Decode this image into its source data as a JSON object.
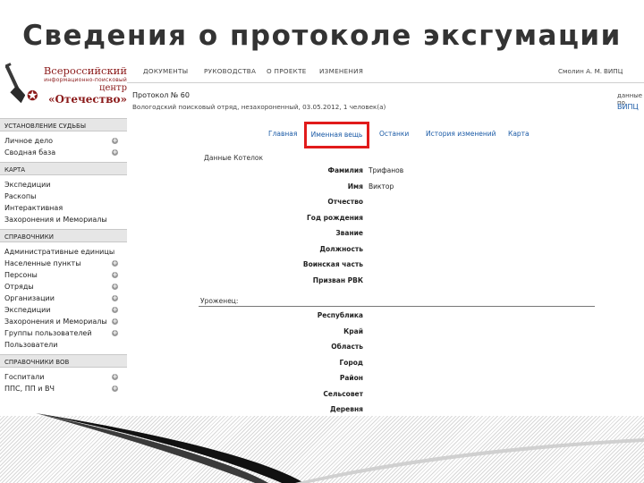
{
  "slide_title": "Сведения о протоколе эксгумации",
  "logo": {
    "line1": "Всероссийский",
    "line2": "информационно-поисковый",
    "line3": "центр",
    "line4": "«Отечество»"
  },
  "topnav": {
    "items": [
      "ДОКУМЕНТЫ",
      "РУКОВОДСТВА",
      "О ПРОЕКТЕ",
      "ИЗМЕНЕНИЯ"
    ],
    "user": "Смолин А. М.",
    "right_link": "ВИПЦ"
  },
  "protocol": {
    "title": "Протокол № 60",
    "subtitle": "Вологодский поисковый отряд, незахороненный, 03.05.2012, 1 человек(а)",
    "side_label": "данные по",
    "side_link": "ВИПЦ"
  },
  "tabs": {
    "main": "Главная",
    "named": "Именная вещь",
    "remains": "Останки",
    "history": "История изменений",
    "map": "Карта"
  },
  "form": {
    "section_title": "Данные Котелок",
    "fields": [
      {
        "label": "Фамилия",
        "value": "Трифанов"
      },
      {
        "label": "Имя",
        "value": "Виктор"
      },
      {
        "label": "Отчество",
        "value": ""
      },
      {
        "label": "Год рождения",
        "value": ""
      },
      {
        "label": "Звание",
        "value": ""
      },
      {
        "label": "Должность",
        "value": ""
      },
      {
        "label": "Воинская часть",
        "value": ""
      },
      {
        "label": "Призван РВК",
        "value": ""
      }
    ],
    "section2_title": "Уроженец:",
    "fields2": [
      {
        "label": "Республика",
        "value": ""
      },
      {
        "label": "Край",
        "value": ""
      },
      {
        "label": "Область",
        "value": ""
      },
      {
        "label": "Город",
        "value": ""
      },
      {
        "label": "Район",
        "value": ""
      },
      {
        "label": "Сельсовет",
        "value": ""
      },
      {
        "label": "Деревня",
        "value": ""
      }
    ]
  },
  "sidebar": {
    "sections": [
      {
        "title": "УСТАНОВЛЕНИЕ СУДЬБЫ",
        "items": [
          {
            "label": "Личное дело",
            "plus": true
          },
          {
            "label": "Сводная база",
            "plus": true
          }
        ]
      },
      {
        "title": "КАРТА",
        "items": [
          {
            "label": "Экспедиции",
            "plus": false
          },
          {
            "label": "Раскопы",
            "plus": false
          },
          {
            "label": "Интерактивная",
            "plus": false
          },
          {
            "label": "Захоронения и Мемориалы",
            "plus": false
          }
        ]
      },
      {
        "title": "СПРАВОЧНИКИ",
        "items": [
          {
            "label": "Административные единицы",
            "plus": false
          },
          {
            "label": "Населенные пункты",
            "plus": true
          },
          {
            "label": "Персоны",
            "plus": true
          },
          {
            "label": "Отряды",
            "plus": true
          },
          {
            "label": "Организации",
            "plus": true
          },
          {
            "label": "Экспедиции",
            "plus": true
          },
          {
            "label": "Захоронения и Мемориалы",
            "plus": true
          },
          {
            "label": "Группы пользователей",
            "plus": true
          },
          {
            "label": "Пользователи",
            "plus": false
          }
        ]
      },
      {
        "title": "СПРАВОЧНИКИ ВОВ",
        "items": [
          {
            "label": "Госпитали",
            "plus": true
          },
          {
            "label": "ППС, ПП и ВЧ",
            "plus": true
          }
        ]
      }
    ]
  },
  "colors": {
    "accent_red": "#e11b1b",
    "link_blue": "#1a5aa6",
    "brand_maroon": "#8b1a1a"
  }
}
